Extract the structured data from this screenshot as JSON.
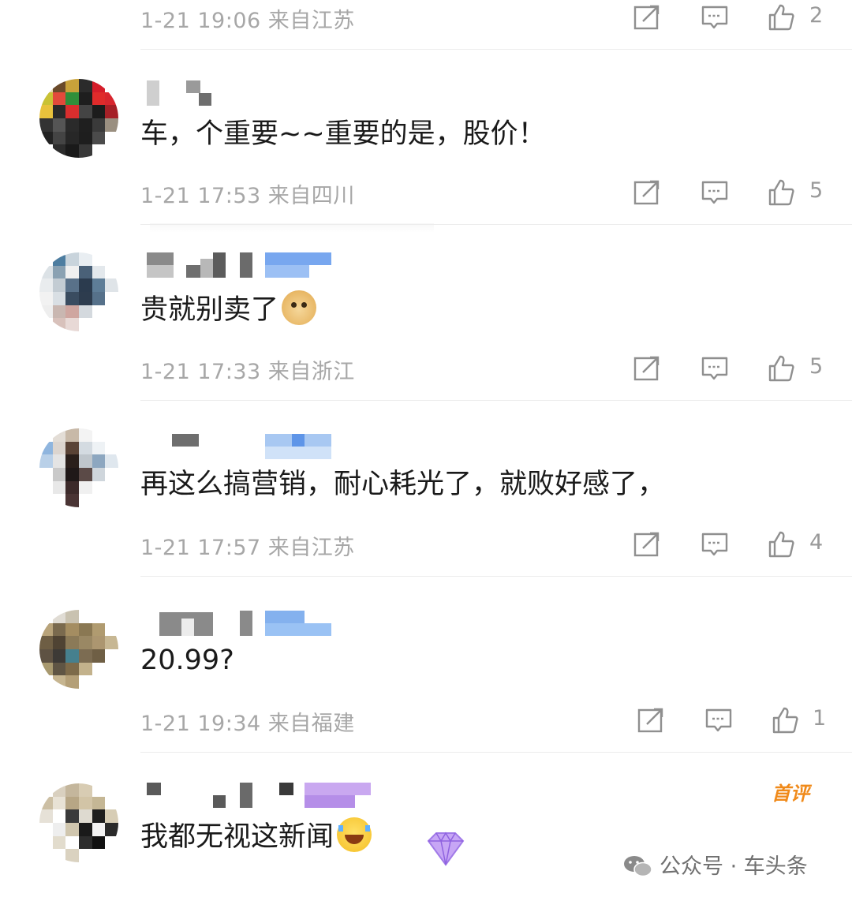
{
  "comments": [
    {
      "time": "1-21 19:06",
      "location": "来自江苏",
      "likes": "2"
    },
    {
      "text": "车，个重要~~重要的是，股价！",
      "time": "1-21 17:53",
      "location": "来自四川",
      "likes": "5"
    },
    {
      "text": "贵就别卖了",
      "emoji": "doge-emoji",
      "time": "1-21 17:33",
      "location": "来自浙江",
      "likes": "5"
    },
    {
      "text": "再这么搞营销，耐心耗光了，就败好感了，",
      "time": "1-21 17:57",
      "location": "来自江苏",
      "likes": "4"
    },
    {
      "text": "20.99?",
      "time": "1-21 19:34",
      "location": "来自福建",
      "likes": "1"
    },
    {
      "text": "我都无视这新闻",
      "emoji": "laugh-cry-emoji",
      "badge": "首评"
    }
  ],
  "icons": {
    "share": "share-icon",
    "reply": "comment-icon",
    "like": "thumbs-up-icon"
  },
  "colors": {
    "meta_text": "#a7a7a7",
    "body_text": "#1a1a1a",
    "badge": "#f08a1a",
    "divider": "#ececec"
  },
  "watermark": {
    "text": "公众号 · 车头条"
  }
}
